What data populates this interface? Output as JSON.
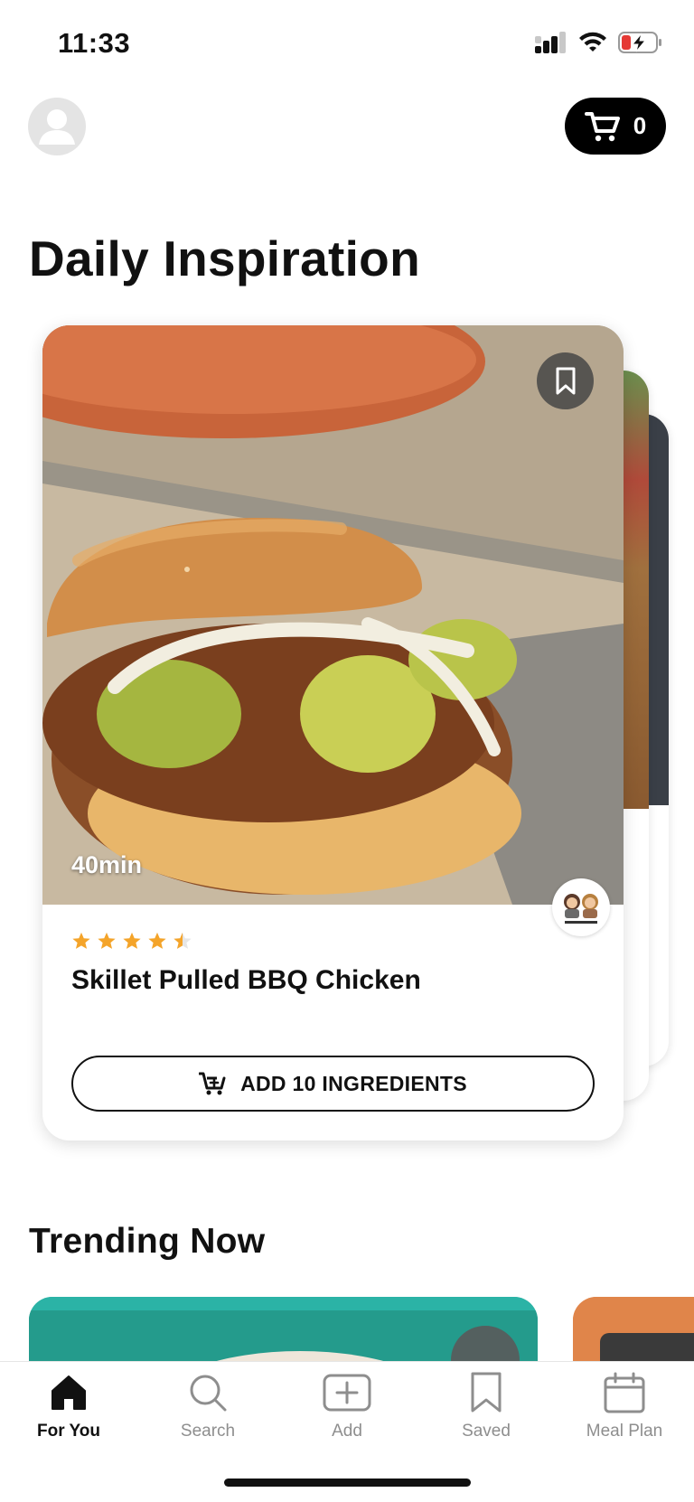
{
  "status_bar": {
    "time": "11:33"
  },
  "header": {
    "cart_count": "0"
  },
  "daily": {
    "title": "Daily Inspiration",
    "card": {
      "duration": "40min",
      "rating": 4.5,
      "title": "Skillet Pulled BBQ Chicken",
      "button_label": "ADD 10 INGREDIENTS"
    }
  },
  "trending": {
    "title": "Trending Now"
  },
  "tab_bar": {
    "items": [
      {
        "label": "For You",
        "icon": "home-icon",
        "active": true
      },
      {
        "label": "Search",
        "icon": "search-icon",
        "active": false
      },
      {
        "label": "Add",
        "icon": "plus-square-icon",
        "active": false
      },
      {
        "label": "Saved",
        "icon": "bookmark-icon",
        "active": false
      },
      {
        "label": "Meal Plan",
        "icon": "calendar-icon",
        "active": false
      }
    ]
  },
  "colors": {
    "star": "#F4A42A",
    "accent": "#000000",
    "battery_low": "#E53935"
  }
}
